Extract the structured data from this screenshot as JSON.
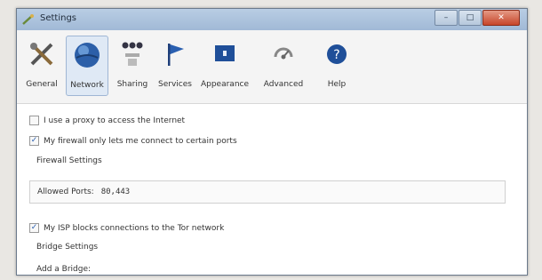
{
  "window": {
    "title": "Settings"
  },
  "toolbar": {
    "items": [
      {
        "label": "General",
        "icon": "general-icon",
        "active": false
      },
      {
        "label": "Network",
        "icon": "network-globe-icon",
        "active": true
      },
      {
        "label": "Sharing",
        "icon": "sharing-icon",
        "active": false
      },
      {
        "label": "Services",
        "icon": "flag-icon",
        "active": false
      },
      {
        "label": "Appearance",
        "icon": "appearance-icon",
        "active": false
      },
      {
        "label": "Advanced",
        "icon": "advanced-icon",
        "active": false
      },
      {
        "label": "Help",
        "icon": "help-icon",
        "active": false
      }
    ]
  },
  "network": {
    "proxy": {
      "label": "I use a proxy to access the Internet",
      "checked": false
    },
    "firewall": {
      "label": "My firewall only lets me connect to certain ports",
      "checked": true
    },
    "firewall_settings_label": "Firewall Settings",
    "allowed_ports": {
      "label": "Allowed Ports:",
      "value": "80,443"
    },
    "isp": {
      "label": "My ISP blocks connections to the Tor network",
      "checked": true
    },
    "bridge_settings_label": "Bridge Settings",
    "add_bridge_label": "Add a Bridge:"
  },
  "colors": {
    "accent": "#2a5fb0",
    "active_tab": "#dfe9f5",
    "titlebar": "#a1b9d6",
    "close": "#c7452a"
  }
}
